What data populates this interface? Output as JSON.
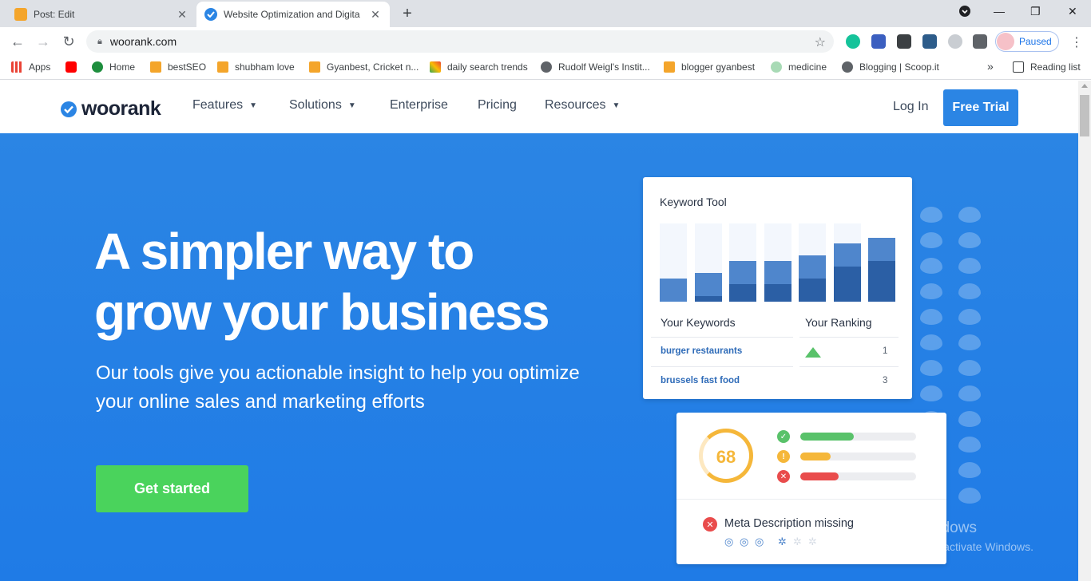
{
  "browser": {
    "tabs": [
      {
        "title": "Post: Edit",
        "favicon": "blogger-icon"
      },
      {
        "title": "Website Optimization and Digita",
        "favicon": "woorank-icon"
      }
    ],
    "url": "woorank.com",
    "profile_label": "Paused",
    "bookmarks": [
      "Apps",
      "Home",
      "bestSEO",
      "shubham love",
      "Gyanbest, Cricket n...",
      "daily search trends",
      "Rudolf Weigl's Instit...",
      "blogger gyanbest",
      "medicine",
      "Blogging | Scoop.it"
    ],
    "bookmarks_more": "»",
    "reading_list": "Reading list"
  },
  "site": {
    "logo": "woorank",
    "nav": [
      "Features",
      "Solutions",
      "Enterprise",
      "Pricing",
      "Resources"
    ],
    "login": "Log In",
    "free_trial": "Free Trial",
    "headline_1": "A simpler way to",
    "headline_2": "grow your business",
    "subline": "Our tools give you actionable insight to help you optimize your online sales and marketing efforts",
    "cta": "Get started"
  },
  "keyword_card": {
    "title": "Keyword Tool",
    "col_keywords": "Your Keywords",
    "col_ranking": "Your Ranking",
    "rows": [
      {
        "keyword": "burger restaurants",
        "rank": "1"
      },
      {
        "keyword": "brussels fast food",
        "rank": "3"
      }
    ]
  },
  "score_card": {
    "score": "68",
    "bars": [
      {
        "status": "pass",
        "fill": 0.46,
        "color": "#59c26a"
      },
      {
        "status": "warning",
        "fill": 0.26,
        "color": "#f5b73a"
      },
      {
        "status": "error",
        "fill": 0.33,
        "color": "#e94c4c"
      }
    ],
    "issue": "Meta Description missing"
  },
  "watermark": {
    "line1": "Activate Windows",
    "line2": "Go to Settings to activate Windows."
  },
  "colors": {
    "brand_blue": "#2b85e4",
    "cta_green": "#4ad35c"
  }
}
